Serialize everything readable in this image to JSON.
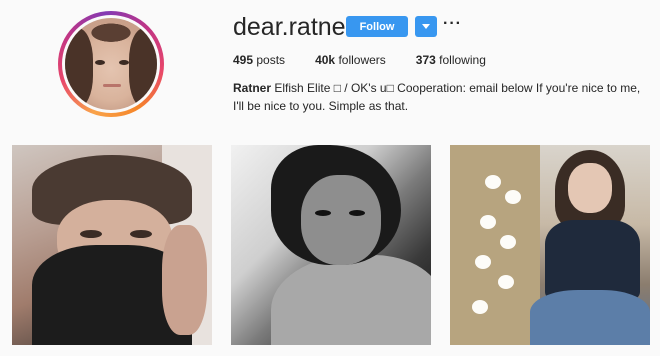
{
  "profile": {
    "username": "dear.ratner",
    "follow_label": "Follow",
    "more_label": "···"
  },
  "stats": {
    "posts_count": "495",
    "posts_label": "posts",
    "followers_count": "40k",
    "followers_label": "followers",
    "following_count": "373",
    "following_label": "following"
  },
  "bio": {
    "name": "Ratner",
    "text": "Elfish Elite □ / OK's u□ Cooperation: email below If you're nice to me, I'll be nice to you. Simple as that."
  },
  "colors": {
    "accent": "#3897f0",
    "background": "#fafafa",
    "text": "#262626"
  },
  "icons": {
    "dropdown": "chevron-down-icon",
    "more": "more-options-icon"
  }
}
